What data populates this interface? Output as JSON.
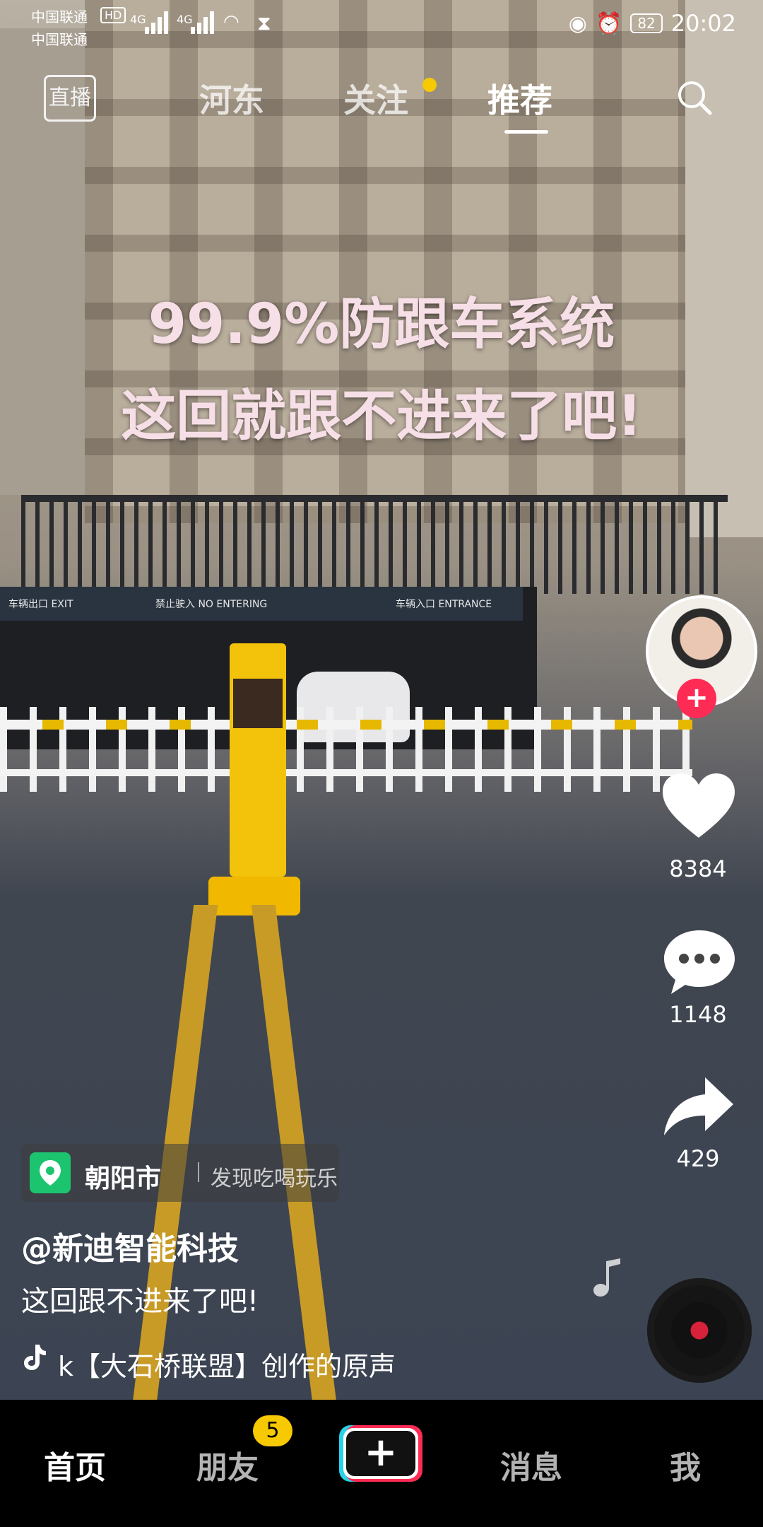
{
  "status_bar": {
    "carrier_1": "中国联通",
    "carrier_2": "中国联通",
    "hd": "HD",
    "signal_1": "4G",
    "signal_2": "4G",
    "battery": "82",
    "time": "20:02"
  },
  "top_nav": {
    "live_label": "直播",
    "tabs": [
      {
        "label": "河东"
      },
      {
        "label": "关注"
      },
      {
        "label": "推荐"
      }
    ],
    "accent_dot_color": "#f7c900"
  },
  "video": {
    "overlay_line_1": "99.9%防跟车系统",
    "overlay_line_2": "这回就跟不进来了吧!",
    "garage_signs": [
      "车辆出口 EXIT",
      "禁止驶入 NO ENTERING",
      "车辆入口 ENTRANCE"
    ]
  },
  "actions": {
    "like_count": "8384",
    "comment_count": "1148",
    "share_count": "429",
    "follow_plus": "+"
  },
  "location": {
    "name": "朝阳市",
    "subtitle": "发现吃喝玩乐"
  },
  "caption": {
    "author": "@新迪智能科技",
    "description": "这回跟不进来了吧!",
    "music": "k【大石桥联盟】创作的原声"
  },
  "bottom_nav": {
    "items": [
      {
        "label": "首页"
      },
      {
        "label": "朋友"
      },
      {
        "label": "+"
      },
      {
        "label": "消息"
      },
      {
        "label": "我"
      }
    ],
    "friends_badge": "5"
  },
  "colors": {
    "brand_red": "#fe2c55",
    "brand_cyan": "#29d3e6",
    "badge_yellow": "#f7c900",
    "location_green": "#1cc46f"
  }
}
